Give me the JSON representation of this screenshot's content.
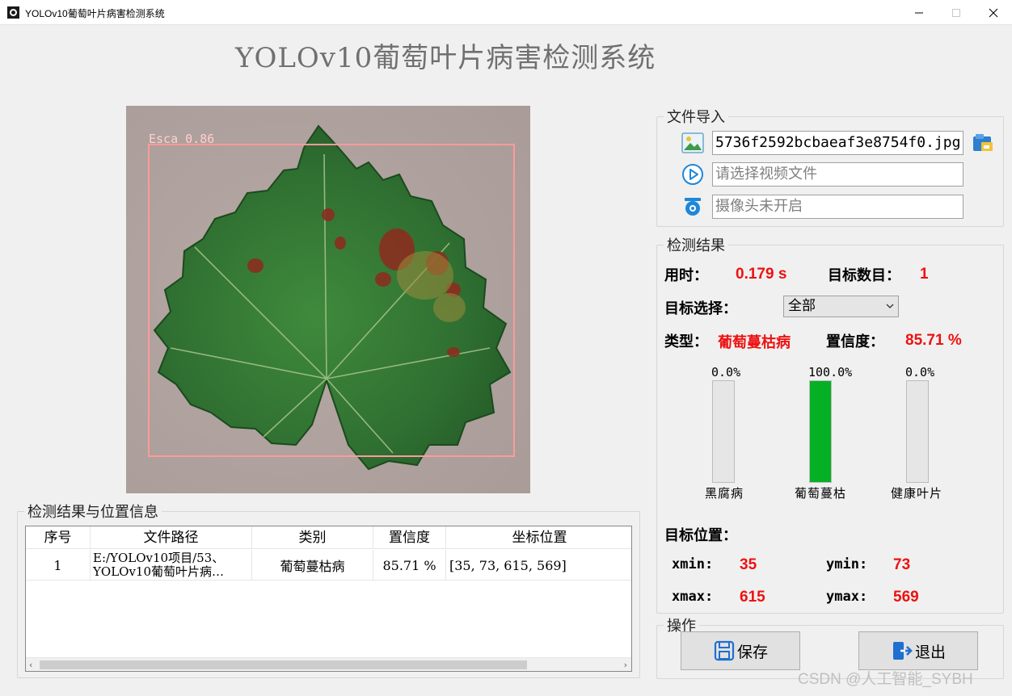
{
  "window": {
    "title": "YOLOv10葡萄叶片病害检测系统",
    "min_glyph": "—",
    "max_glyph": "☐",
    "close_glyph": "✕"
  },
  "app_title": "YOLOv10葡萄叶片病害检测系统",
  "image": {
    "detection_label": "Esca 0.86",
    "box_color": "#ff9a9a"
  },
  "file_import": {
    "legend": "文件导入",
    "image_path": "5736f2592bcbaeaf3e8754f0.jpg",
    "video_placeholder": "请选择视频文件",
    "camera_status": "摄像头未开启",
    "icons": [
      "picture-icon",
      "video-play-icon",
      "camera-icon",
      "open-folder-icon"
    ]
  },
  "results": {
    "legend": "检测结果",
    "time_label": "用时：",
    "time_value": "0.179 s",
    "count_label": "目标数目：",
    "count_value": "1",
    "select_label": "目标选择：",
    "select_value": "全部",
    "type_label": "类型：",
    "type_value": "葡萄蔓枯病",
    "conf_label": "置信度：",
    "conf_value": "85.71 %",
    "bars": [
      {
        "name": "黑腐病",
        "percent_label": "0.0%",
        "value": 0.0
      },
      {
        "name": "葡萄蔓枯",
        "percent_label": "100.0%",
        "value": 100.0
      },
      {
        "name": "健康叶片",
        "percent_label": "0.0%",
        "value": 0.0
      }
    ],
    "bar_color": "#06b025",
    "position_label": "目标位置：",
    "xmin_label": "xmin:",
    "xmin_value": "35",
    "ymin_label": "ymin:",
    "ymin_value": "73",
    "xmax_label": "xmax:",
    "xmax_value": "615",
    "ymax_label": "ymax:",
    "ymax_value": "569",
    "accent_color": "#ee1111"
  },
  "operations": {
    "legend": "操作",
    "save_label": "保存",
    "exit_label": "退出"
  },
  "table": {
    "legend": "检测结果与位置信息",
    "headers": [
      "序号",
      "文件路径",
      "类别",
      "置信度",
      "坐标位置"
    ],
    "rows": [
      {
        "index": "1",
        "path_line1": "E:/YOLOv10项目/53、",
        "path_line2": "YOLOv10葡萄叶片病…",
        "category": "葡萄蔓枯病",
        "confidence": "85.71 %",
        "coords": "[35, 73, 615, 569]"
      }
    ]
  },
  "watermark": "CSDN @人工智能_SYBH"
}
